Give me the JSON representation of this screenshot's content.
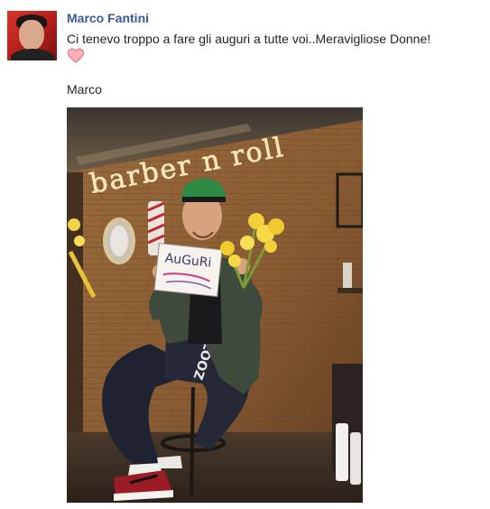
{
  "post": {
    "author": "Marco Fantini",
    "message": "Ci tenevo troppo a fare gli auguri a tutte voi..Meravigliose Donne!",
    "emoji": "heart-icon",
    "signature": "Marco",
    "photo": {
      "neon_sign": "barber n roll",
      "held_sign": "AuGuRi",
      "shirt_print": "ZOOT"
    }
  },
  "colors": {
    "author_link": "#3b5998",
    "body_text": "#1d2129",
    "heart": "#f28b95"
  }
}
